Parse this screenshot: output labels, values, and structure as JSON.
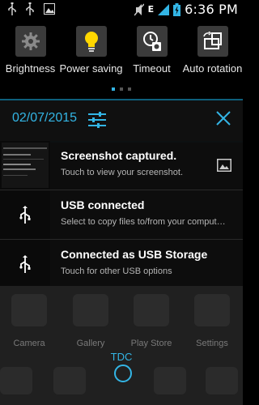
{
  "status_bar": {
    "time": "6:36",
    "ampm": "PM",
    "network_type": "E",
    "icons": [
      "usb-icon",
      "usb-icon",
      "image-icon",
      "mute-icon",
      "signal-icon",
      "battery-icon"
    ]
  },
  "quick_settings": {
    "tiles": [
      {
        "label": "Brightness",
        "icon": "gear-icon"
      },
      {
        "label": "Power saving",
        "icon": "lightbulb-icon"
      },
      {
        "label": "Timeout",
        "icon": "timeout-icon"
      },
      {
        "label": "Auto rotation",
        "icon": "rotation-icon"
      }
    ],
    "page_count": 3,
    "active_page": 1
  },
  "date_row": {
    "date": "02/07/2015",
    "settings_icon": "sliders-icon",
    "clear_icon": "close-icon"
  },
  "notifications": [
    {
      "title": "Screenshot captured.",
      "subtitle": "Touch to view your screenshot.",
      "thumb": "screenshot-thumbnail",
      "side_icon": "image-icon"
    },
    {
      "title": "USB connected",
      "subtitle": "Select to copy files to/from your comput…",
      "thumb": "usb-icon"
    },
    {
      "title": "Connected as USB Storage",
      "subtitle": "Touch for other USB options",
      "thumb": "usb-icon"
    }
  ],
  "home": {
    "apps": [
      "Camera",
      "Gallery",
      "Play Store",
      "Settings"
    ],
    "carrier": "TDC"
  },
  "colors": {
    "accent": "#33b5e5",
    "divider": "#0e5f7c",
    "tile_bg": "#3b3b3b"
  }
}
